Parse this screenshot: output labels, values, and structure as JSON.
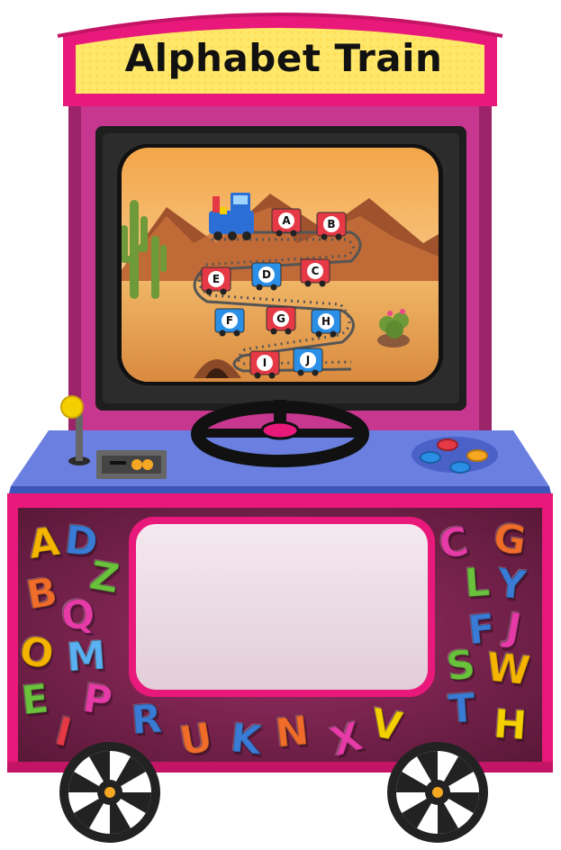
{
  "title": "Alphabet Train",
  "game": {
    "train_cars": [
      {
        "letter": "A",
        "color": "#e63946"
      },
      {
        "letter": "B",
        "color": "#e63946"
      },
      {
        "letter": "C",
        "color": "#e63946"
      },
      {
        "letter": "D",
        "color": "#2b8fe6"
      },
      {
        "letter": "E",
        "color": "#e63946"
      },
      {
        "letter": "F",
        "color": "#2b8fe6"
      },
      {
        "letter": "G",
        "color": "#e63946"
      },
      {
        "letter": "H",
        "color": "#2b8fe6"
      },
      {
        "letter": "I",
        "color": "#e63946"
      },
      {
        "letter": "J",
        "color": "#2b8fe6"
      }
    ]
  },
  "decor_letters": [
    {
      "char": "A",
      "color": "#f5b400"
    },
    {
      "char": "D",
      "color": "#3a7bd5"
    },
    {
      "char": "Z",
      "color": "#6ac23c"
    },
    {
      "char": "B",
      "color": "#f06c2a"
    },
    {
      "char": "Q",
      "color": "#e63ba6"
    },
    {
      "char": "O",
      "color": "#f5b400"
    },
    {
      "char": "M",
      "color": "#5ab0f0"
    },
    {
      "char": "E",
      "color": "#6ac23c"
    },
    {
      "char": "P",
      "color": "#e63ba6"
    },
    {
      "char": "I",
      "color": "#e63946"
    },
    {
      "char": "R",
      "color": "#3a7bd5"
    },
    {
      "char": "U",
      "color": "#f06c2a"
    },
    {
      "char": "K",
      "color": "#3a7bd5"
    },
    {
      "char": "N",
      "color": "#f06c2a"
    },
    {
      "char": "X",
      "color": "#e63ba6"
    },
    {
      "char": "V",
      "color": "#f5d000"
    },
    {
      "char": "C",
      "color": "#e63ba6"
    },
    {
      "char": "G",
      "color": "#f06c2a"
    },
    {
      "char": "L",
      "color": "#6ac23c"
    },
    {
      "char": "Y",
      "color": "#3a7bd5"
    },
    {
      "char": "F",
      "color": "#3a7bd5"
    },
    {
      "char": "J",
      "color": "#e63ba6"
    },
    {
      "char": "S",
      "color": "#6ac23c"
    },
    {
      "char": "W",
      "color": "#f5b400"
    },
    {
      "char": "T",
      "color": "#3a7bd5"
    },
    {
      "char": "H",
      "color": "#f5d000"
    }
  ],
  "colors": {
    "cabinet_purple": "#c7368f",
    "cabinet_pink": "#e8197a",
    "panel_blue": "#6a7fe0",
    "marquee_yellow": "#ffe76a",
    "sky": "#f7c98a",
    "sand": "#e8a455"
  },
  "icons": [
    "joystick-icon",
    "coin-slot-icon",
    "steering-wheel-icon",
    "arcade-buttons-icon",
    "wheel-icon"
  ]
}
